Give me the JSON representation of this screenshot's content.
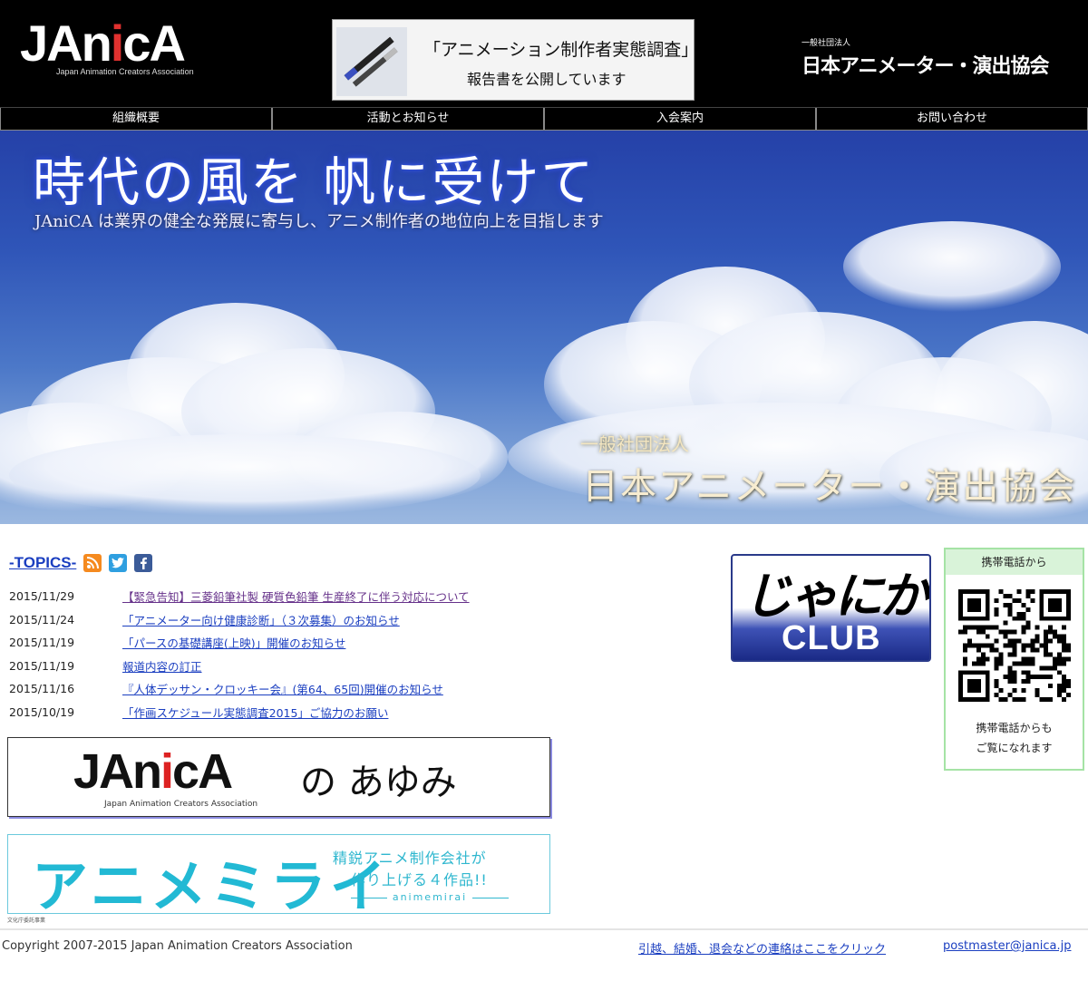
{
  "header": {
    "logo_text_a": "JAn",
    "logo_text_i": "i",
    "logo_text_b": "cA",
    "logo_sub": "Japan Animation Creators Association",
    "banner_line1": "「アニメーション制作者実態調査」",
    "banner_line2": "報告書を公開しています",
    "org_small": "一般社団法人",
    "org_big": "日本アニメーター・演出協会"
  },
  "nav": {
    "items": [
      "組織概要",
      "活動とお知らせ",
      "入会案内",
      "お問い合わせ"
    ]
  },
  "hero": {
    "headline": "時代の風を 帆に受けて",
    "tagline": "JAniCA は業界の健全な発展に寄与し、アニメ制作者の地位向上を目指します",
    "org_small": "一般社団法人",
    "org_big": "日本アニメーター・演出協会"
  },
  "topics": {
    "title": "-TOPICS-",
    "icons": [
      "rss-icon",
      "twitter-icon",
      "facebook-icon"
    ],
    "items": [
      {
        "date": "2015/11/29",
        "text": "【緊急告知】三菱鉛筆社製 硬質色鉛筆 生産終了に伴う対応について"
      },
      {
        "date": "2015/11/24",
        "text": "「アニメーター向け健康診断」（３次募集）のお知らせ"
      },
      {
        "date": "2015/11/19",
        "text": "「パースの基礎講座(上映)」開催のお知らせ"
      },
      {
        "date": "2015/11/19",
        "text": "報道内容の訂正"
      },
      {
        "date": "2015/11/16",
        "text": "『人体デッサン・クロッキー会』(第64、65回)開催のお知らせ"
      },
      {
        "date": "2015/10/19",
        "text": "「作画スケジュール実態調査2015」ご協力のお願い"
      }
    ]
  },
  "ayumi": {
    "logo_a": "JAn",
    "logo_i": "i",
    "logo_b": "cA",
    "logo_sub": "Japan Animation Creators Association",
    "title": "の あゆみ"
  },
  "animemirai": {
    "wordmark": "アニメミライ",
    "line1": "精鋭アニメ制作会社が",
    "line2": "作り上げる４作品!!",
    "line3": "animemirai",
    "note": "文化庁委託事業"
  },
  "club": {
    "script": "じゃにか",
    "word": "CLUB"
  },
  "mobile": {
    "header": "携帯電話から",
    "text1": "携帯電話からも",
    "text2": "ご覧になれます"
  },
  "footer": {
    "copyright": "Copyright 2007-2015 Japan Animation Creators Association",
    "contact": "引越、結婚、退会などの連絡はここをクリック",
    "email": "postmaster@janica.jp"
  },
  "colors": {
    "link": "#1a3ec0",
    "visited": "#66318a",
    "nav_bg": "#000000",
    "mobile_border": "#a5e3a5",
    "animemirai": "#22b9d4"
  }
}
